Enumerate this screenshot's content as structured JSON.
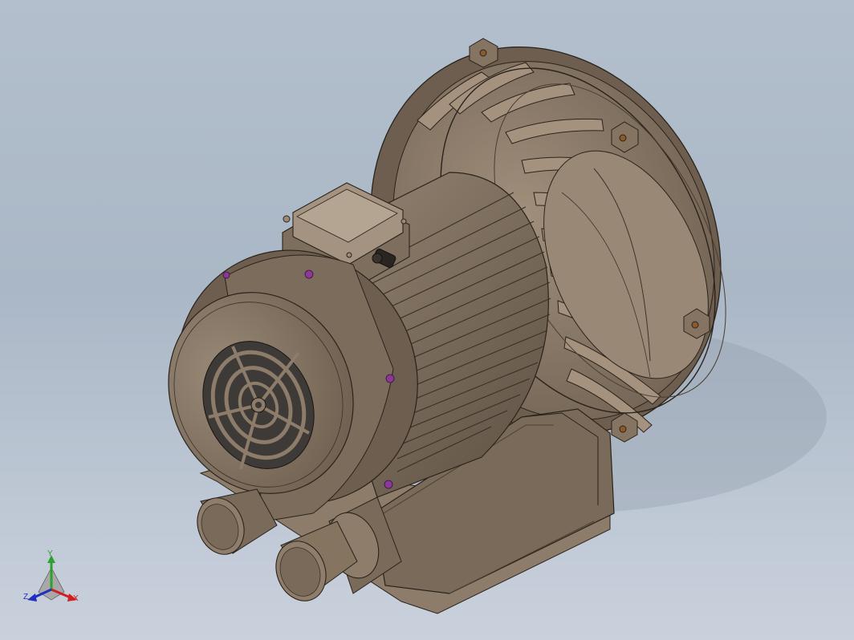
{
  "viewport": {
    "background_top": "#b3bfcc",
    "background_bottom": "#c9d1dc"
  },
  "model": {
    "body_color": "#857462",
    "body_dark": "#5e5143",
    "body_light": "#a8998a",
    "edge_color": "#2a231c",
    "fastener_color": "#8a3a95",
    "bolt_color": "#8b5a2b"
  },
  "triad": {
    "x_label": "X",
    "y_label": "Y",
    "z_label": "Z",
    "x_color": "#d02020",
    "y_color": "#2ea02e",
    "z_color": "#2030c0"
  }
}
